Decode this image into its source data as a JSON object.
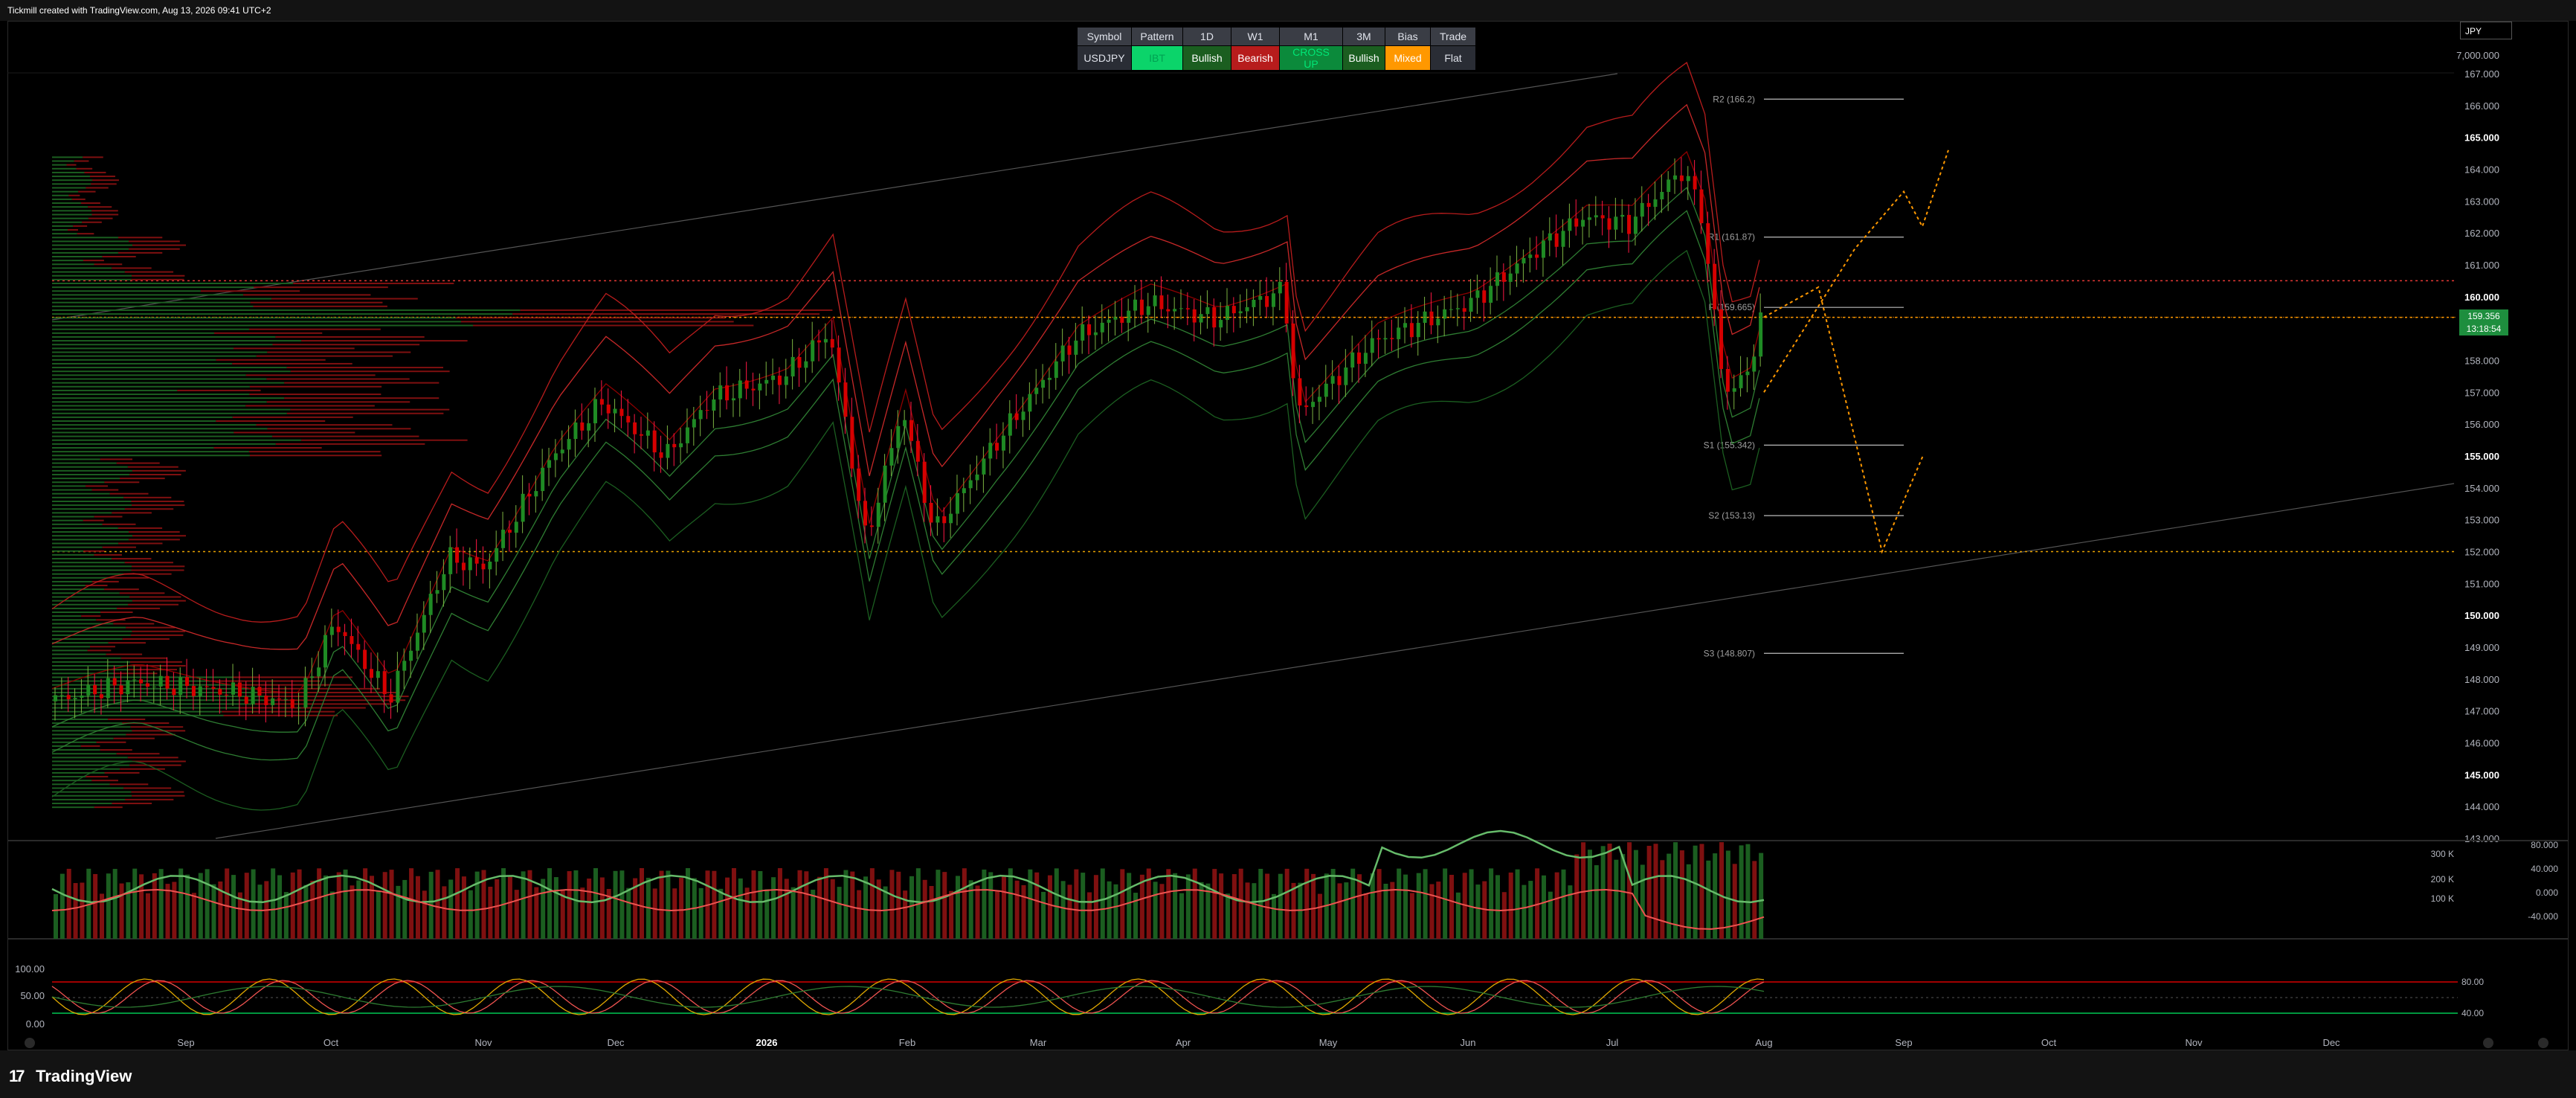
{
  "header": {
    "title": "Tickmill created with TradingView.com, Aug 13, 2026 09:41 UTC+2"
  },
  "footer": {
    "brand": "TradingView",
    "logo_glyph": "17"
  },
  "currency": "JPY",
  "table": {
    "headers": [
      "Symbol",
      "Pattern",
      "1D",
      "W1",
      "M1",
      "3M",
      "Bias",
      "Trade"
    ],
    "row": [
      {
        "text": "USDJPY",
        "bg": "#2a2d35",
        "color": "#e0e3eb"
      },
      {
        "text": "IBT",
        "bg": "#00e676",
        "color": "#00e676"
      },
      {
        "text": "Bullish",
        "bg": "#1b5e20",
        "color": "#ffffff"
      },
      {
        "text": "Bearish",
        "bg": "#b71c1c",
        "color": "#ffffff"
      },
      {
        "text": "CROSS UP",
        "bg": "#00c853",
        "color": "#00e676"
      },
      {
        "text": "Bullish",
        "bg": "#1b5e20",
        "color": "#ffffff"
      },
      {
        "text": "Mixed",
        "bg": "#ff9800",
        "color": "#ffffff"
      },
      {
        "text": "Flat",
        "bg": "#2a2d35",
        "color": "#e0e3eb"
      }
    ]
  },
  "last_price": {
    "value": "159.356",
    "countdown": "13:18:54",
    "bg": "#1e8e3e"
  },
  "colors": {
    "up": "#1f8b24",
    "down": "#d50000",
    "grid": "#111111",
    "orange": "#ff9800"
  },
  "chart_data": [
    {
      "type": "candlestick",
      "ylim": [
        143,
        167
      ],
      "yticks": [
        "143.000",
        "144.000",
        "145.000",
        "146.000",
        "147.000",
        "148.000",
        "149.000",
        "150.000",
        "151.000",
        "152.000",
        "153.000",
        "154.000",
        "155.000",
        "156.000",
        "157.000",
        "158.000",
        "159.000",
        "160.000",
        "161.000",
        "162.000",
        "163.000",
        "164.000",
        "165.000",
        "166.000",
        "167.000"
      ],
      "top_tick": "7,000.000",
      "xticks": [
        "Sep",
        "Oct",
        "Nov",
        "Dec",
        "2026",
        "Feb",
        "Mar",
        "Apr",
        "May",
        "Jun",
        "Jul",
        "Aug",
        "Sep",
        "Oct",
        "Nov",
        "Dec"
      ],
      "pivots": [
        {
          "label": "R2 (166.2)",
          "value": 166.2
        },
        {
          "label": "R1 (161.87)",
          "value": 161.87
        },
        {
          "label": "P (159.665)",
          "value": 159.665
        },
        {
          "label": "S1 (155.342)",
          "value": 155.342
        },
        {
          "label": "S2 (153.13)",
          "value": 153.13
        },
        {
          "label": "S3 (148.807)",
          "value": 148.807
        }
      ],
      "levels": [
        160.5,
        159.35,
        152.0
      ],
      "path_key": [
        {
          "date": "2025-08-01",
          "close": 147.3
        },
        {
          "date": "2025-08-20",
          "close": 147.9
        },
        {
          "date": "2025-09-10",
          "close": 147.6
        },
        {
          "date": "2025-09-25",
          "close": 147.2
        },
        {
          "date": "2025-10-03",
          "close": 149.8
        },
        {
          "date": "2025-10-15",
          "close": 147.4
        },
        {
          "date": "2025-10-28",
          "close": 151.8
        },
        {
          "date": "2025-11-05",
          "close": 151.5
        },
        {
          "date": "2025-11-20",
          "close": 155.0
        },
        {
          "date": "2025-12-01",
          "close": 156.7
        },
        {
          "date": "2025-12-15",
          "close": 155.0
        },
        {
          "date": "2025-12-25",
          "close": 156.8
        },
        {
          "date": "2026-01-10",
          "close": 157.5
        },
        {
          "date": "2026-01-20",
          "close": 158.9
        },
        {
          "date": "2026-01-28",
          "close": 152.3
        },
        {
          "date": "2026-02-05",
          "close": 156.5
        },
        {
          "date": "2026-02-12",
          "close": 152.6
        },
        {
          "date": "2026-02-25",
          "close": 155.3
        },
        {
          "date": "2026-03-15",
          "close": 158.7
        },
        {
          "date": "2026-03-31",
          "close": 159.8
        },
        {
          "date": "2026-04-15",
          "close": 159.3
        },
        {
          "date": "2026-04-30",
          "close": 160.2
        },
        {
          "date": "2026-05-03",
          "close": 156.3
        },
        {
          "date": "2026-05-20",
          "close": 158.6
        },
        {
          "date": "2026-06-10",
          "close": 159.8
        },
        {
          "date": "2026-06-25",
          "close": 161.5
        },
        {
          "date": "2026-07-05",
          "close": 162.5
        },
        {
          "date": "2026-07-15",
          "close": 162.3
        },
        {
          "date": "2026-07-27",
          "close": 164.0
        },
        {
          "date": "2026-07-31",
          "close": 162.6
        },
        {
          "date": "2026-08-05",
          "close": 157.0
        },
        {
          "date": "2026-08-10",
          "close": 157.5
        },
        {
          "date": "2026-08-13",
          "close": 159.356
        }
      ],
      "projection": [
        {
          "date": "2026-08-13",
          "close": 159.356
        },
        {
          "date": "2026-08-25",
          "close": 160.3
        },
        {
          "date": "2026-09-08",
          "close": 152.0
        },
        {
          "date": "2026-09-17",
          "close": 155.0
        }
      ]
    },
    {
      "type": "volume",
      "y1ticks": [
        "100 K",
        "200 K",
        "300 K"
      ],
      "y2ticks": [
        "80.000",
        "40.000",
        "0.000",
        "-40.000"
      ]
    },
    {
      "type": "oscillator",
      "yticks": [
        "0.00",
        "50.00",
        "100.00"
      ],
      "levels": [
        "80.00",
        "40.00"
      ]
    }
  ]
}
